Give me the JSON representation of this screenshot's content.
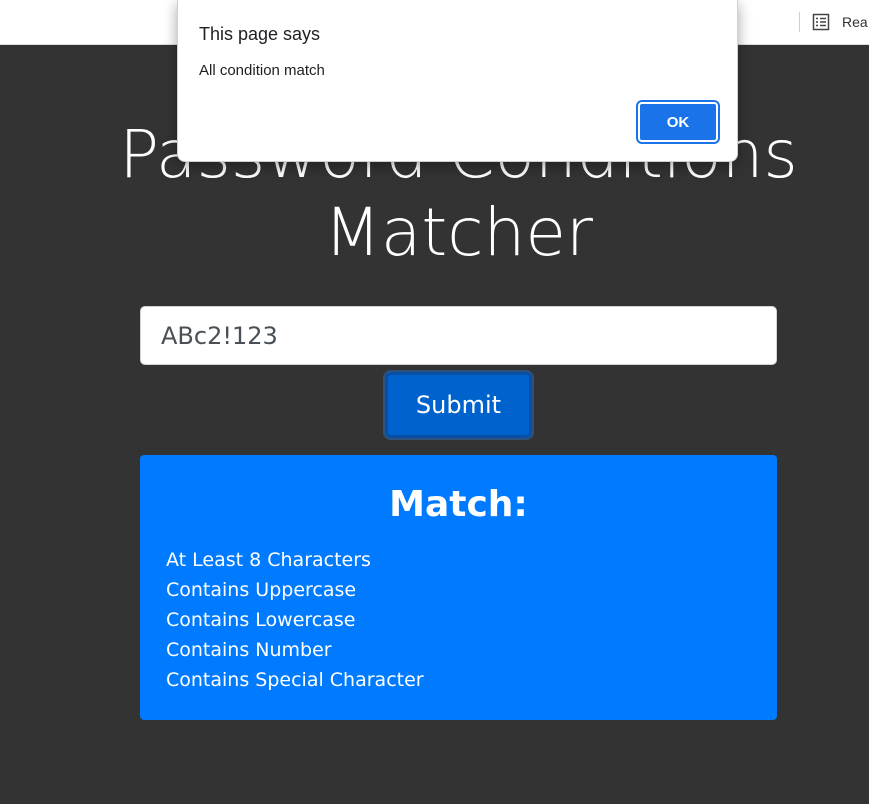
{
  "browser": {
    "reader_label": "Rea"
  },
  "page": {
    "title_line1": "Password Conditions",
    "title_line2": "Matcher"
  },
  "form": {
    "password_value": "ABc2!123",
    "submit_label": "Submit"
  },
  "result": {
    "heading": "Match:",
    "conditions": [
      "At Least 8 Characters",
      "Contains Uppercase",
      "Contains Lowercase",
      "Contains Number",
      "Contains Special Character"
    ]
  },
  "dialog": {
    "title": "This page says",
    "message": "All condition match",
    "ok_label": "OK"
  },
  "colors": {
    "background": "#333333",
    "primary": "#007bff",
    "button": "#0062cc",
    "dialog_button": "#1a73e8"
  },
  "icons": {
    "reader_mode": "reader-mode-icon"
  }
}
